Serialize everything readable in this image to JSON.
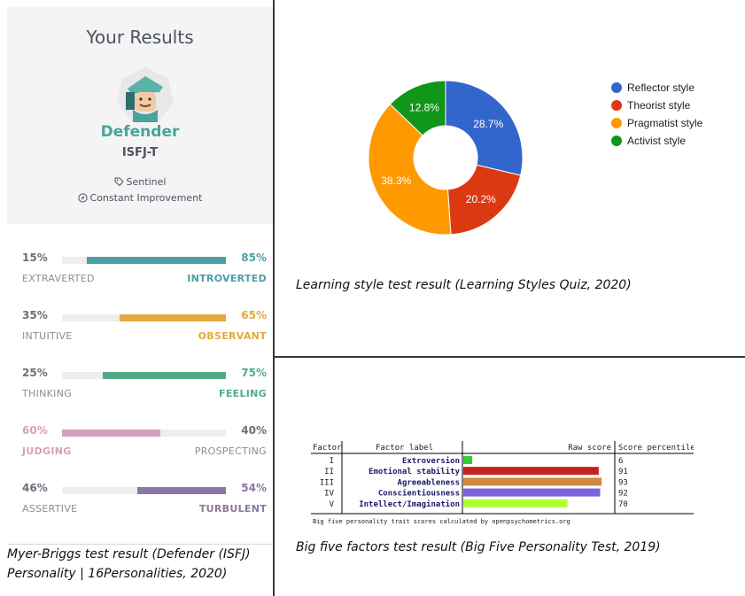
{
  "results": {
    "title": "Your Results",
    "type_name": "Defender",
    "type_code": "ISFJ-T",
    "role": "Sentinel",
    "strategy": "Constant Improvement"
  },
  "traits": [
    {
      "left_pct": "15%",
      "right_pct": "85%",
      "left_label": "EXTRAVERTED",
      "right_label": "INTROVERTED",
      "fill_side": "right",
      "fill_fraction": 0.85,
      "color": "#4a9fa5",
      "dominant": "right"
    },
    {
      "left_pct": "35%",
      "right_pct": "65%",
      "left_label": "INTUITIVE",
      "right_label": "OBSERVANT",
      "fill_side": "right",
      "fill_fraction": 0.65,
      "color": "#e2a93c",
      "dominant": "right"
    },
    {
      "left_pct": "25%",
      "right_pct": "75%",
      "left_label": "THINKING",
      "right_label": "FEELING",
      "fill_side": "right",
      "fill_fraction": 0.75,
      "color": "#4fab86",
      "dominant": "right"
    },
    {
      "left_pct": "60%",
      "right_pct": "40%",
      "left_label": "JUDGING",
      "right_label": "PROSPECTING",
      "fill_side": "left",
      "fill_fraction": 0.6,
      "color": "#d49fbc",
      "dominant": "left"
    },
    {
      "left_pct": "46%",
      "right_pct": "54%",
      "left_label": "ASSERTIVE",
      "right_label": "TURBULENT",
      "fill_side": "right",
      "fill_fraction": 0.54,
      "color": "#8b77a1",
      "dominant": "right"
    }
  ],
  "captions": {
    "mbti": "Myer-Briggs test result (Defender (ISFJ) Personality | 16Personalities, 2020)",
    "learning": "Learning style test result (Learning Styles Quiz, 2020)",
    "bigfive": "Big five factors test result (Big Five Personality Test, 2019)"
  },
  "chart_data": [
    {
      "type": "pie",
      "title": "",
      "donut": true,
      "legend_position": "right",
      "series": [
        {
          "name": "Reflector style",
          "value": 28.7,
          "label": "28.7%",
          "color": "#3366cc"
        },
        {
          "name": "Theorist style",
          "value": 20.2,
          "label": "20.2%",
          "color": "#dc3912"
        },
        {
          "name": "Pragmatist style",
          "value": 38.3,
          "label": "38.3%",
          "color": "#ff9900"
        },
        {
          "name": "Activist style",
          "value": 12.8,
          "label": "12.8%",
          "color": "#109618"
        }
      ]
    },
    {
      "type": "bar",
      "orientation": "horizontal",
      "title": "",
      "headers": {
        "factor": "Factor",
        "label": "Factor label",
        "raw": "Raw score",
        "percentile": "Score percentile"
      },
      "footer": "Big five personality trait scores calculated by openpsychometrics.org",
      "rows": [
        {
          "factor": "I",
          "label": "Extroversion",
          "percentile": 6,
          "color": "#33cc33"
        },
        {
          "factor": "II",
          "label": "Emotional stability",
          "percentile": 91,
          "color": "#c42121"
        },
        {
          "factor": "III",
          "label": "Agreeableness",
          "percentile": 93,
          "color": "#d2893f"
        },
        {
          "factor": "IV",
          "label": "Conscientiousness",
          "percentile": 92,
          "color": "#7a63dd"
        },
        {
          "factor": "V",
          "label": "Intellect/Imagination",
          "percentile": 70,
          "color": "#adff2f"
        }
      ]
    }
  ]
}
